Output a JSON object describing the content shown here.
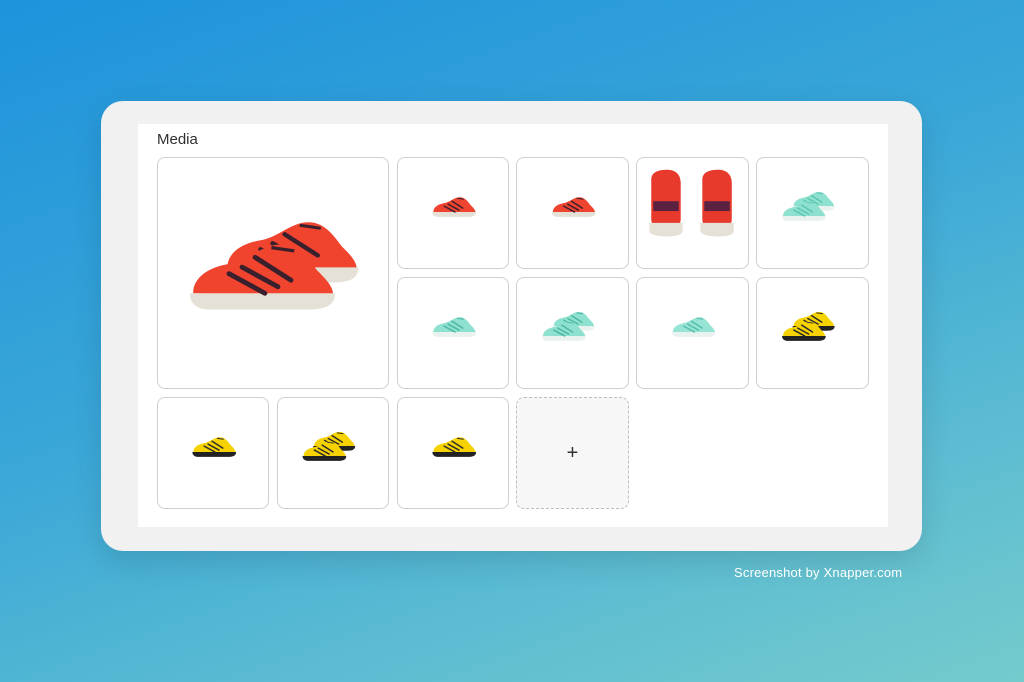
{
  "media": {
    "title": "Media",
    "add_label": "+",
    "items": [
      {
        "colorway": "red",
        "shoe": "#f0442e",
        "sole": "#e6e1d6",
        "stripe": "#3a1f2c",
        "view": "pair-angled"
      },
      {
        "colorway": "red",
        "shoe": "#ef4530",
        "sole": "#e6e1d6",
        "stripe": "#3a1f2c",
        "view": "side"
      },
      {
        "colorway": "red",
        "shoe": "#ef4530",
        "sole": "#e6e1d6",
        "stripe": "#3a1f2c",
        "view": "side"
      },
      {
        "colorway": "red",
        "shoe": "#e83a2c",
        "sole": "#e6e1d6",
        "stripe": "#5a2140",
        "view": "back"
      },
      {
        "colorway": "mint",
        "shoe": "#8ee0cf",
        "sole": "#e9f2ef",
        "stripe": "#5bc6b2",
        "view": "pair"
      },
      {
        "colorway": "mint",
        "shoe": "#8ee0cf",
        "sole": "#e9f2ef",
        "stripe": "#4eb7a3",
        "view": "side"
      },
      {
        "colorway": "mint",
        "shoe": "#8ee0cf",
        "sole": "#e9f2ef",
        "stripe": "#4eb7a3",
        "view": "pair"
      },
      {
        "colorway": "mint",
        "shoe": "#97e3d4",
        "sole": "#e9f2ef",
        "stripe": "#56bfab",
        "view": "side"
      },
      {
        "colorway": "yellow",
        "shoe": "#f5d200",
        "sole": "#222222",
        "stripe": "#2b2b2b",
        "view": "pair"
      },
      {
        "colorway": "yellow",
        "shoe": "#f5d200",
        "sole": "#222222",
        "stripe": "#2b2b2b",
        "view": "side"
      },
      {
        "colorway": "yellow",
        "shoe": "#f5d200",
        "sole": "#222222",
        "stripe": "#2b2b2b",
        "view": "pair"
      },
      {
        "colorway": "yellow",
        "shoe": "#f5d200",
        "sole": "#222222",
        "stripe": "#2b2b2b",
        "view": "side"
      }
    ]
  },
  "footer": {
    "credit": "Screenshot by Xnapper.com"
  }
}
